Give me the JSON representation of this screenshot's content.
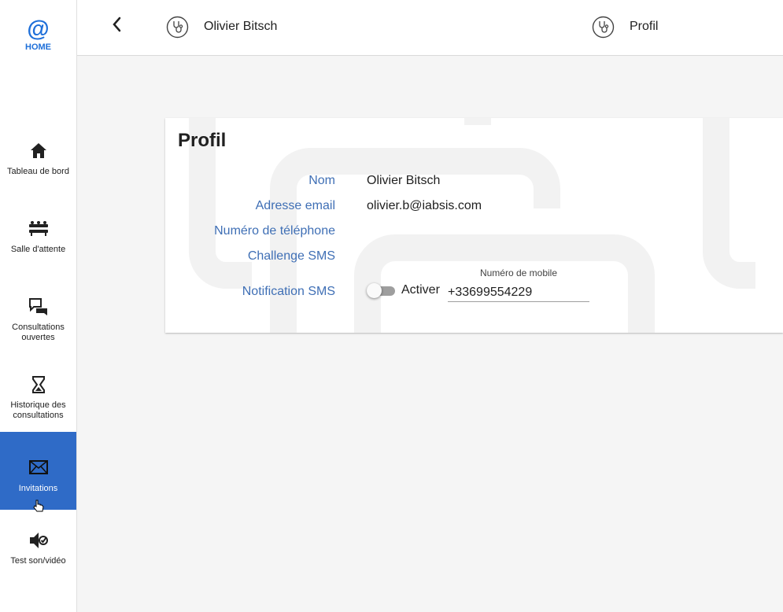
{
  "sidebar": {
    "logo_symbol": "@",
    "logo_label": "HOME",
    "items": [
      {
        "label": "Tableau de bord",
        "icon": "home-icon"
      },
      {
        "label": "Salle d'attente",
        "icon": "waiting-room-icon"
      },
      {
        "label": "Consultations ouvertes",
        "icon": "chat-bubbles-icon"
      },
      {
        "label": "Historique des consultations",
        "icon": "hourglass-icon"
      },
      {
        "label": "Invitations",
        "icon": "mail-icon",
        "active": true
      },
      {
        "label": "Test son/vidéo",
        "icon": "speaker-check-icon"
      }
    ],
    "active_color": "#2f6bc7"
  },
  "header": {
    "user_name": "Olivier Bitsch",
    "page_name": "Profil",
    "icons": [
      "back-arrow-icon",
      "stethoscope-icon"
    ]
  },
  "profile": {
    "title": "Profil",
    "fields": [
      {
        "label": "Nom",
        "value": "Olivier Bitsch"
      },
      {
        "label": "Adresse email",
        "value": "olivier.b@iabsis.com"
      },
      {
        "label": "Numéro de téléphone",
        "value": ""
      },
      {
        "label": "Challenge SMS",
        "value": ""
      },
      {
        "label": "Notification SMS",
        "value": ""
      }
    ],
    "sms_toggle_label": "Activer",
    "sms_toggle_on": false,
    "mobile_field_label": "Numéro de mobile",
    "mobile_field_value": "+33699554229"
  },
  "colors": {
    "accent": "#1e6fd9",
    "label": "#3f6fb5"
  }
}
